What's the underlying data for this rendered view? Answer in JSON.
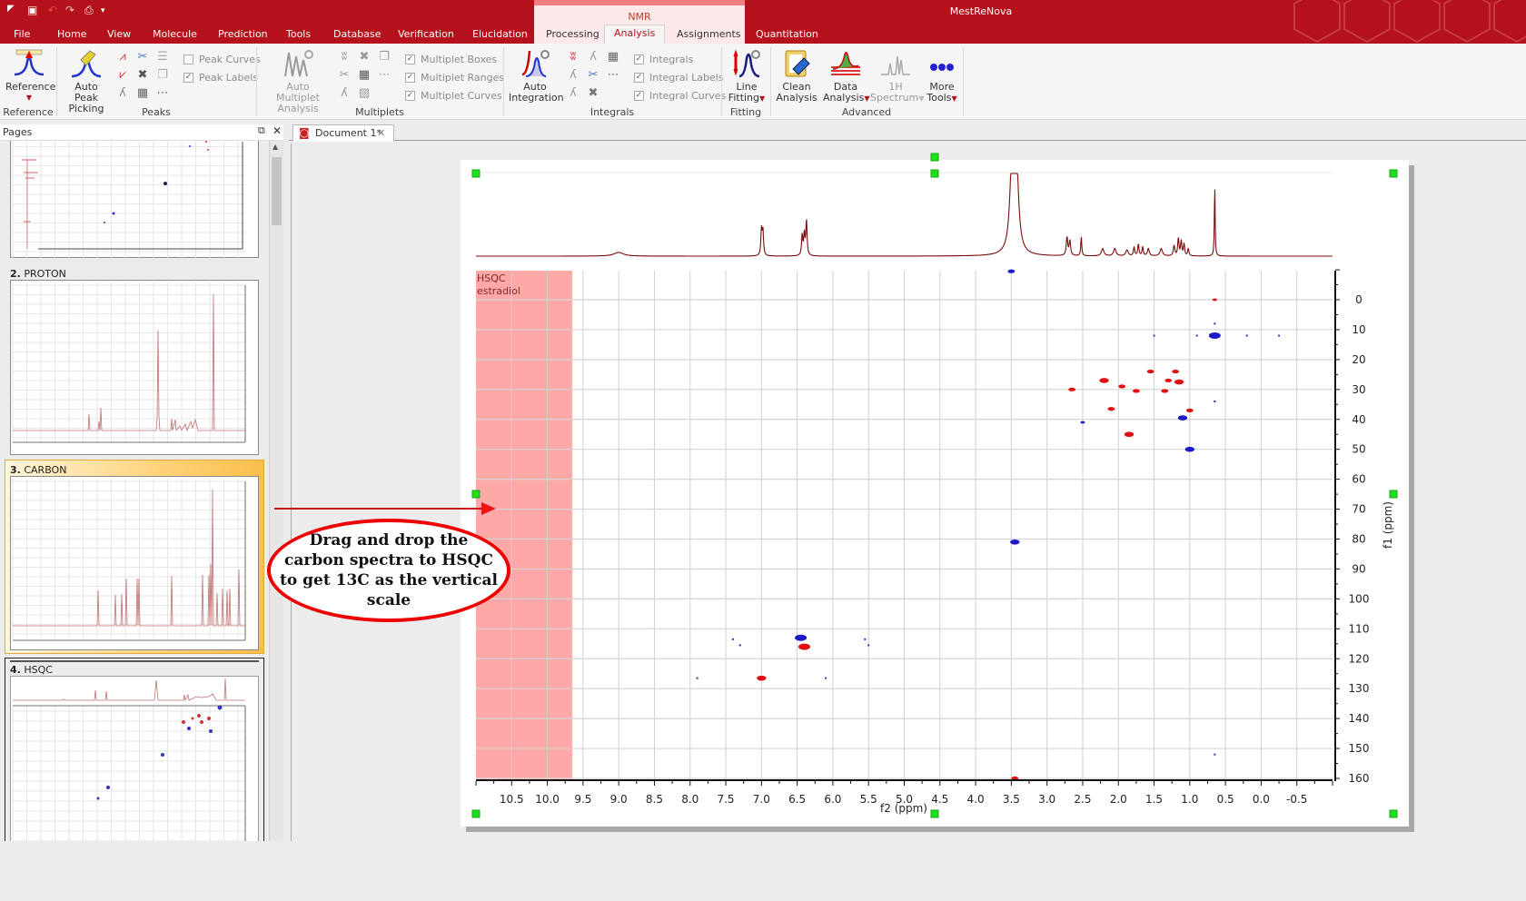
{
  "app": {
    "title": "MestReNova",
    "contextual_group": "NMR",
    "quick_access": [
      "app-menu",
      "save",
      "undo",
      "redo",
      "print",
      "customize"
    ]
  },
  "tabs": [
    {
      "label": "File"
    },
    {
      "label": "Home"
    },
    {
      "label": "View"
    },
    {
      "label": "Molecule"
    },
    {
      "label": "Prediction"
    },
    {
      "label": "Tools"
    },
    {
      "label": "Database"
    },
    {
      "label": "Verification"
    },
    {
      "label": "Elucidation"
    },
    {
      "label": "Processing"
    },
    {
      "label": "Analysis",
      "active": true
    },
    {
      "label": "Assignments"
    },
    {
      "label": "Quantitation"
    }
  ],
  "ribbon": {
    "groups": {
      "reference": "Reference",
      "peaks": "Peaks",
      "multiplets": "Multiplets",
      "integrals": "Integrals",
      "fitting": "Fitting",
      "advanced": "Advanced"
    },
    "buttons": {
      "reference": "Reference",
      "auto_peak_1": "Auto Peak",
      "auto_peak_2": "Picking",
      "auto_mult_1": "Auto Multiplet",
      "auto_mult_2": "Analysis",
      "auto_int_1": "Auto",
      "auto_int_2": "Integration",
      "line_fit_1": "Line",
      "line_fit_2": "Fitting",
      "clean_1": "Clean",
      "clean_2": "Analysis",
      "data_an_1": "Data",
      "data_an_2": "Analysis",
      "spec_1": "1H",
      "spec_2": "Spectrum",
      "more_1": "More",
      "more_2": "Tools"
    },
    "checkboxes": {
      "peak_curves": {
        "label": "Peak Curves",
        "checked": false
      },
      "peak_labels": {
        "label": "Peak Labels",
        "checked": true
      },
      "multiplet_boxes": {
        "label": "Multiplet Boxes",
        "checked": true
      },
      "multiplet_ranges": {
        "label": "Multiplet Ranges",
        "checked": true
      },
      "multiplet_curves": {
        "label": "Multiplet Curves",
        "checked": true
      },
      "integrals": {
        "label": "Integrals",
        "checked": true
      },
      "integral_labels": {
        "label": "Integral Labels",
        "checked": true
      },
      "integral_curves": {
        "label": "Integral Curves",
        "checked": true
      }
    },
    "check_mark": "✓"
  },
  "pages_panel": {
    "title": "Pages",
    "pages": [
      {
        "num": "2.",
        "name": "PROTON"
      },
      {
        "num": "3.",
        "name": "CARBON",
        "selected": true
      },
      {
        "num": "4.",
        "name": "HSQC"
      }
    ]
  },
  "document": {
    "tab_label": "Document 1*",
    "spectrum_label_1": "HSQC",
    "spectrum_label_2": "estradiol"
  },
  "annotation": {
    "text": "Drag and drop  the carbon spectra to HSQC to get 13C as the vertical scale",
    "color": "#e00000"
  },
  "colors": {
    "brand": "#b5121b",
    "trace": "#7a0c0c",
    "positive_contour": "#e01010",
    "negative_contour": "#1a1ac8",
    "highlight_region": "#ffa8a8",
    "handle": "#1ee01e"
  },
  "chart_data": {
    "type": "heatmap",
    "title": "HSQC estradiol",
    "xlabel": "f2 (ppm)",
    "ylabel": "f1 (ppm)",
    "xlim": [
      11.0,
      -1.0
    ],
    "ylim": [
      -10,
      162
    ],
    "x_ticks": [
      10.5,
      10.0,
      9.5,
      9.0,
      8.5,
      8.0,
      7.5,
      7.0,
      6.5,
      6.0,
      5.5,
      5.0,
      4.5,
      4.0,
      3.5,
      3.0,
      2.5,
      2.0,
      1.5,
      1.0,
      0.5,
      0.0,
      -0.5
    ],
    "y_ticks": [
      0,
      10,
      20,
      30,
      40,
      50,
      60,
      70,
      80,
      90,
      100,
      110,
      120,
      130,
      140,
      150,
      160
    ],
    "grid": true,
    "highlight_range_f2": [
      11.0,
      9.65
    ],
    "proton_projection_peaks": [
      {
        "ppm": 9.0,
        "h": 0.05,
        "w": 0.08
      },
      {
        "ppm": 7.0,
        "h": 0.35,
        "w": 0.01
      },
      {
        "ppm": 6.98,
        "h": 0.33,
        "w": 0.01
      },
      {
        "ppm": 6.43,
        "h": 0.28,
        "w": 0.01
      },
      {
        "ppm": 6.4,
        "h": 0.28,
        "w": 0.01
      },
      {
        "ppm": 6.37,
        "h": 0.48,
        "w": 0.01
      },
      {
        "ppm": 3.49,
        "h": 1.2,
        "w": 0.035
      },
      {
        "ppm": 3.43,
        "h": 1.2,
        "w": 0.035
      },
      {
        "ppm": 2.72,
        "h": 0.25,
        "w": 0.012
      },
      {
        "ppm": 2.68,
        "h": 0.2,
        "w": 0.012
      },
      {
        "ppm": 2.52,
        "h": 0.26,
        "w": 0.008
      },
      {
        "ppm": 2.22,
        "h": 0.1,
        "w": 0.02
      },
      {
        "ppm": 2.05,
        "h": 0.1,
        "w": 0.02
      },
      {
        "ppm": 1.88,
        "h": 0.08,
        "w": 0.02
      },
      {
        "ppm": 1.78,
        "h": 0.12,
        "w": 0.01
      },
      {
        "ppm": 1.72,
        "h": 0.16,
        "w": 0.01
      },
      {
        "ppm": 1.66,
        "h": 0.12,
        "w": 0.01
      },
      {
        "ppm": 1.58,
        "h": 0.1,
        "w": 0.015
      },
      {
        "ppm": 1.4,
        "h": 0.1,
        "w": 0.02
      },
      {
        "ppm": 1.22,
        "h": 0.14,
        "w": 0.012
      },
      {
        "ppm": 1.16,
        "h": 0.24,
        "w": 0.01
      },
      {
        "ppm": 1.12,
        "h": 0.2,
        "w": 0.01
      },
      {
        "ppm": 1.08,
        "h": 0.16,
        "w": 0.01
      },
      {
        "ppm": 1.02,
        "h": 0.1,
        "w": 0.01
      },
      {
        "ppm": 0.65,
        "h": 1.0,
        "w": 0.006
      }
    ],
    "cross_peaks": [
      {
        "f2": 2.65,
        "f1": 30,
        "sign": "positive",
        "size": 3
      },
      {
        "f2": 2.2,
        "f1": 27,
        "sign": "positive",
        "size": 4
      },
      {
        "f2": 2.1,
        "f1": 36.5,
        "sign": "positive",
        "size": 3
      },
      {
        "f2": 1.95,
        "f1": 29,
        "sign": "positive",
        "size": 3
      },
      {
        "f2": 1.85,
        "f1": 45,
        "sign": "positive",
        "size": 4
      },
      {
        "f2": 1.75,
        "f1": 30.5,
        "sign": "positive",
        "size": 3
      },
      {
        "f2": 1.55,
        "f1": 24,
        "sign": "positive",
        "size": 3
      },
      {
        "f2": 1.3,
        "f1": 27,
        "sign": "positive",
        "size": 3
      },
      {
        "f2": 1.2,
        "f1": 24,
        "sign": "positive",
        "size": 3
      },
      {
        "f2": 1.15,
        "f1": 27.5,
        "sign": "positive",
        "size": 4
      },
      {
        "f2": 1.0,
        "f1": 37,
        "sign": "positive",
        "size": 3
      },
      {
        "f2": 1.35,
        "f1": 30.5,
        "sign": "positive",
        "size": 3
      },
      {
        "f2": 2.5,
        "f1": 41,
        "sign": "negative",
        "size": 2
      },
      {
        "f2": 1.1,
        "f1": 39.5,
        "sign": "negative",
        "size": 4
      },
      {
        "f2": 1.0,
        "f1": 50,
        "sign": "negative",
        "size": 4
      },
      {
        "f2": 0.65,
        "f1": 12,
        "sign": "negative",
        "size": 5
      },
      {
        "f2": 0.65,
        "f1": 0,
        "sign": "positive",
        "size": 2
      },
      {
        "f2": 3.45,
        "f1": 81,
        "sign": "negative",
        "size": 4
      },
      {
        "f2": 6.45,
        "f1": 113,
        "sign": "negative",
        "size": 5
      },
      {
        "f2": 6.4,
        "f1": 116,
        "sign": "positive",
        "size": 5
      },
      {
        "f2": 7.0,
        "f1": 126.5,
        "sign": "positive",
        "size": 4
      },
      {
        "f2": 3.45,
        "f1": 160,
        "sign": "positive",
        "size": 3
      },
      {
        "f2": 3.5,
        "f1": -9.5,
        "sign": "negative",
        "size": 3
      }
    ],
    "artifact_points": [
      {
        "f2": 7.4,
        "f1": 113.5
      },
      {
        "f2": 7.3,
        "f1": 115.5
      },
      {
        "f2": 7.9,
        "f1": 126.5
      },
      {
        "f2": 6.1,
        "f1": 126.5
      },
      {
        "f2": 5.55,
        "f1": 113.5
      },
      {
        "f2": 5.5,
        "f1": 115.5
      },
      {
        "f2": 1.5,
        "f1": 12
      },
      {
        "f2": 0.9,
        "f1": 12
      },
      {
        "f2": 0.2,
        "f1": 12
      },
      {
        "f2": -0.25,
        "f1": 12
      },
      {
        "f2": 0.65,
        "f1": 34
      },
      {
        "f2": 0.65,
        "f1": 152
      },
      {
        "f2": 0.65,
        "f1": 8
      }
    ]
  }
}
